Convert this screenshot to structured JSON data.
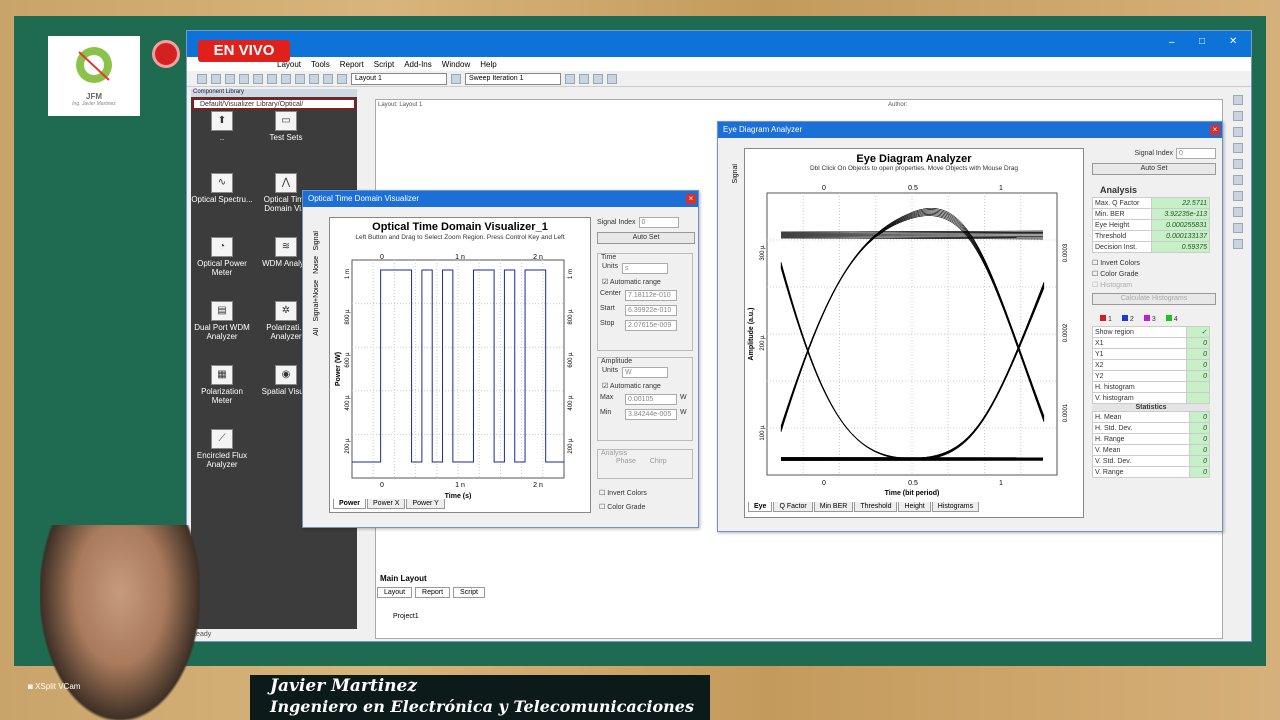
{
  "menu": {
    "items": [
      "Layout",
      "Tools",
      "Report",
      "Script",
      "Add-Ins",
      "Window",
      "Help"
    ]
  },
  "toolbar": {
    "layout_combo": "Layout 1",
    "sweep_combo": "Sweep Iteration 1"
  },
  "library": {
    "header": "Component Library",
    "path": "Default/Visualizer Library/Optical/",
    "items": [
      "..",
      "Test Sets",
      "Optical Spectru...",
      "Optical Time Domain Vi...",
      "Optical Power Meter",
      "WDM Analy...",
      "Dual Port WDM Analyzer",
      "Polarizati... Analyzer",
      "Polarization Meter",
      "Spatial Visu...",
      "Encircled Flux Analyzer"
    ]
  },
  "canvas": {
    "layout_label": "Layout: Layout 1",
    "author_label": "Author:",
    "bottom_tab": "Main Layout",
    "tabs": [
      "Layout",
      "Report",
      "Script"
    ],
    "project": "Project1",
    "status": "Ready"
  },
  "otdv": {
    "window_title": "Optical Time Domain Visualizer",
    "plot_title": "Optical Time Domain Visualizer_1",
    "hint": "Left Button and Drag to Select Zoom Region. Press Control Key and Left",
    "side_tabs": [
      "Signal",
      "Noise",
      "Signal+Noise",
      "All"
    ],
    "signal_index_label": "Signal Index",
    "signal_index": "0",
    "auto_set": "Auto Set",
    "time": {
      "group": "Time",
      "units_label": "Units",
      "units": "s",
      "auto_range": "Automatic range",
      "center_label": "Center",
      "center": "7.18112e-010",
      "start_label": "Start",
      "start": "6.39922e-010",
      "stop_label": "Stop",
      "stop": "2.07615e-009"
    },
    "amplitude": {
      "group": "Amplitude",
      "units_label": "Units",
      "units": "W",
      "auto_range": "Automatic range",
      "max_label": "Max",
      "max": "0.00105",
      "min_label": "Min",
      "min": "3.84244e-005",
      "unit": "W"
    },
    "analysis": {
      "group": "Analysis",
      "phase": "Phase",
      "chirp": "Chirp"
    },
    "invert_colors": "Invert Colors",
    "color_grade": "Color Grade",
    "xlabel": "Time (s)",
    "ylabel": "Power (W)",
    "xticks": [
      "0",
      "1 n",
      "2 n"
    ],
    "yticks": [
      "1 m",
      "800 µ",
      "600 µ",
      "400 µ",
      "200 µ"
    ],
    "bottom_tabs": [
      "Power",
      "Power X",
      "Power Y"
    ]
  },
  "eye": {
    "window_title": "Eye Diagram Analyzer",
    "plot_title": "Eye Diagram Analyzer",
    "hint": "Dbl Click On Objects to open properties.  Move Objects with Mouse Drag",
    "side_tab": "Signal",
    "signal_index_label": "Signal Index",
    "signal_index": "0",
    "auto_set": "Auto Set",
    "analysis_label": "Analysis",
    "analysis": [
      {
        "k": "Max. Q Factor",
        "v": "22.5711"
      },
      {
        "k": "Min. BER",
        "v": "3.92235e-113"
      },
      {
        "k": "Eye Height",
        "v": "0.000255831"
      },
      {
        "k": "Threshold",
        "v": "0.000133137"
      },
      {
        "k": "Decision Inst.",
        "v": "0.59375"
      }
    ],
    "invert_colors": "Invert Colors",
    "color_grade": "Color Grade",
    "histogram": "Histogram",
    "calc_hist": "Calculate Histograms",
    "marker_tabs": [
      "1",
      "2",
      "3",
      "4"
    ],
    "marker_colors": [
      "#d81b1b",
      "#1b3ad8",
      "#c41bd8",
      "#1bc41b"
    ],
    "markers": [
      {
        "k": "Show region",
        "v": "✓"
      },
      {
        "k": "X1",
        "v": "0"
      },
      {
        "k": "Y1",
        "v": "0"
      },
      {
        "k": "X2",
        "v": "0"
      },
      {
        "k": "Y2",
        "v": "0"
      },
      {
        "k": "H. histogram",
        "v": ""
      },
      {
        "k": "V. histogram",
        "v": ""
      }
    ],
    "stats_header": "Statistics",
    "stats": [
      {
        "k": "H. Mean",
        "v": "0"
      },
      {
        "k": "H. Std. Dev.",
        "v": "0"
      },
      {
        "k": "H. Range",
        "v": "0"
      },
      {
        "k": "V. Mean",
        "v": "0"
      },
      {
        "k": "V. Std. Dev.",
        "v": "0"
      },
      {
        "k": "V. Range",
        "v": "0"
      }
    ],
    "xlabel": "Time (bit period)",
    "ylabel": "Amplitude (a.u.)",
    "xticks": [
      "0",
      "0.5",
      "1"
    ],
    "yticks": [
      "300 µ",
      "200 µ",
      "100 µ"
    ],
    "ryticks": [
      "0.0003",
      "0.0002",
      "0.0001"
    ],
    "bottom_tabs": [
      "Eye",
      "Q Factor",
      "Min BER",
      "Threshold",
      "Height",
      "Histograms"
    ]
  },
  "overlay": {
    "live": "EN VIVO",
    "logo_text": "JFM",
    "logo_sub": "Ing. Javier Martinez",
    "xsplit": "XSplit VCam",
    "name": "Javier Martinez",
    "subtitle": "Ingeniero en Electrónica y Telecomunicaciones"
  }
}
